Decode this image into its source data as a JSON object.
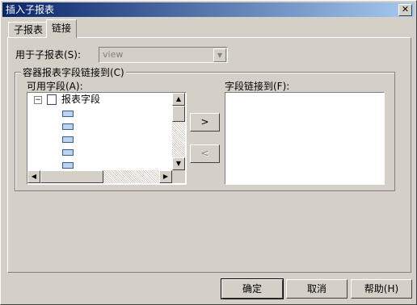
{
  "window": {
    "title": "插入子报表",
    "close_symbol": "✕"
  },
  "tabs": [
    {
      "label": "子报表",
      "active": false
    },
    {
      "label": "链接",
      "active": true
    }
  ],
  "subreport": {
    "label": "用于子报表(S):",
    "value": "view"
  },
  "container_group": {
    "legend": "容器报表字段链接到(C)"
  },
  "available_fields": {
    "label": "可用字段(A):",
    "root": "报表字段",
    "expander": "⊟"
  },
  "linked_fields": {
    "label": "字段链接到(F):"
  },
  "move_buttons": {
    "add": ">",
    "remove": "<"
  },
  "buttons": {
    "ok": "确定",
    "cancel": "取消",
    "help": "帮助(H)"
  },
  "icons": {
    "close": "close-icon",
    "expander": "tree-collapse-icon",
    "report": "report-icon",
    "field": "field-icon",
    "arrow_up": "scroll-up-icon",
    "arrow_down": "scroll-down-icon",
    "arrow_left": "scroll-left-icon",
    "arrow_right": "scroll-right-icon",
    "dropdown": "chevron-down-icon"
  }
}
